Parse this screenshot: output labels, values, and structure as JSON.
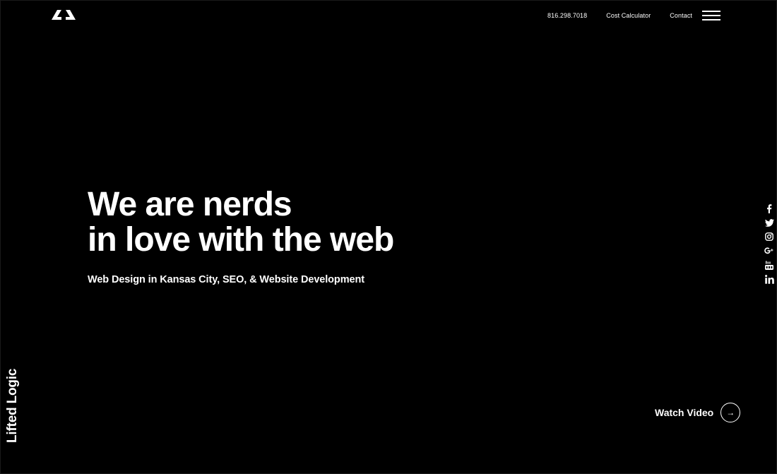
{
  "header": {
    "logo_icon": "lifted-logic-logo-icon",
    "phone": "816.298.7018",
    "nav_cost_calculator": "Cost Calculator",
    "nav_contact": "Contact",
    "menu_icon": "hamburger-menu-icon"
  },
  "hero": {
    "title_line1": "We are nerds",
    "title_line2": "in love with the web",
    "subtitle": "Web Design in Kansas City, SEO, & Website Development"
  },
  "brand": {
    "name": "Lifted Logic"
  },
  "social": {
    "icons": [
      "facebook-icon",
      "twitter-icon",
      "instagram-icon",
      "google-plus-icon",
      "youtube-icon",
      "linkedin-icon"
    ]
  },
  "watch_video": {
    "label": "Watch Video",
    "arrow": "→"
  },
  "colors": {
    "background": "#000000",
    "text": "#ffffff"
  }
}
